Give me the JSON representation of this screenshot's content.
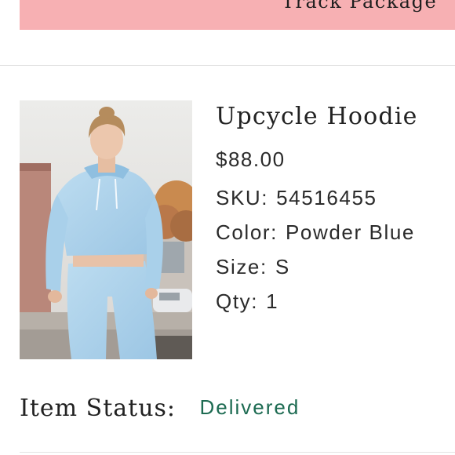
{
  "header": {
    "track_button_label": "Track Package"
  },
  "product": {
    "name": "Upcycle Hoodie",
    "price": "$88.00",
    "sku_label": "SKU:",
    "sku_value": "54516455",
    "color_label": "Color:",
    "color_value": "Powder Blue",
    "size_label": "Size:",
    "size_value": "S",
    "qty_label": "Qty:",
    "qty_value": "1"
  },
  "status": {
    "label": "Item Status:",
    "value": "Delivered"
  },
  "colors": {
    "track_button_bg": "#f7b0b3",
    "status_delivered": "#1d6b52",
    "divider": "#e4e4e4"
  }
}
